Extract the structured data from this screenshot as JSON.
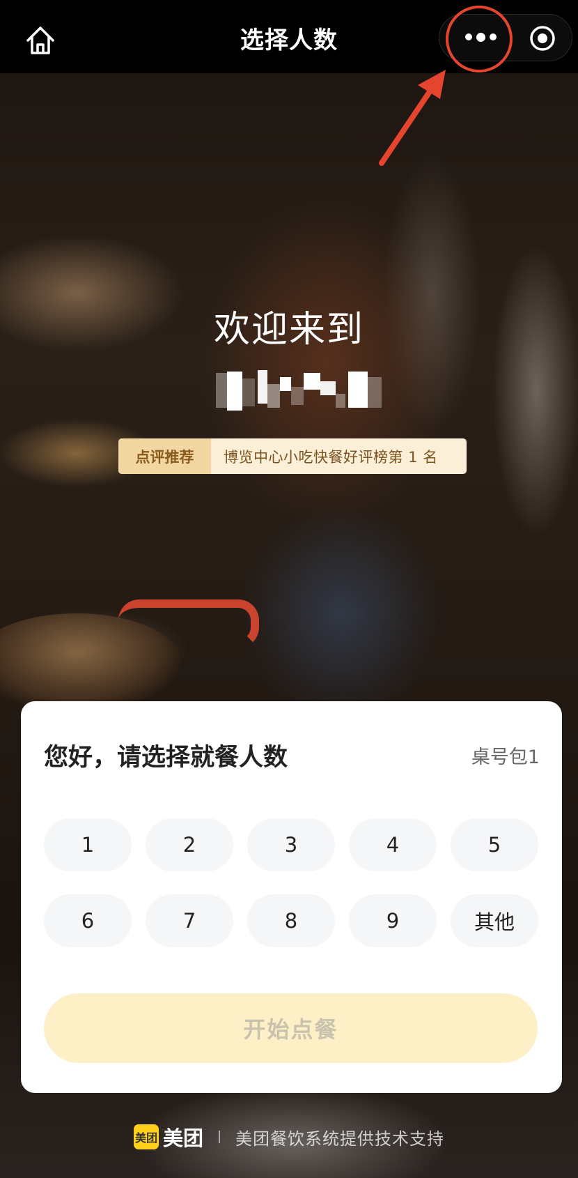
{
  "nav": {
    "title": "选择人数"
  },
  "welcome": {
    "greeting": "欢迎来到"
  },
  "recommendation": {
    "tag": "点评推荐",
    "text": "博览中心小吃快餐好评榜第 1 名"
  },
  "card": {
    "title": "您好，请选择就餐人数",
    "table_no": "桌号包1",
    "options": [
      "1",
      "2",
      "3",
      "4",
      "5",
      "6",
      "7",
      "8",
      "9",
      "其他"
    ],
    "start_label": "开始点餐"
  },
  "footer": {
    "logo_text": "美团",
    "brand": "美团",
    "support_text": "美团餐饮系统提供技术支持"
  },
  "colors": {
    "accent_disabled_bg": "#fdf0c7",
    "annotation": "#e5442f",
    "brand_yellow": "#ffd11a"
  },
  "icons": [
    "home-icon",
    "more-icon",
    "target-icon"
  ]
}
